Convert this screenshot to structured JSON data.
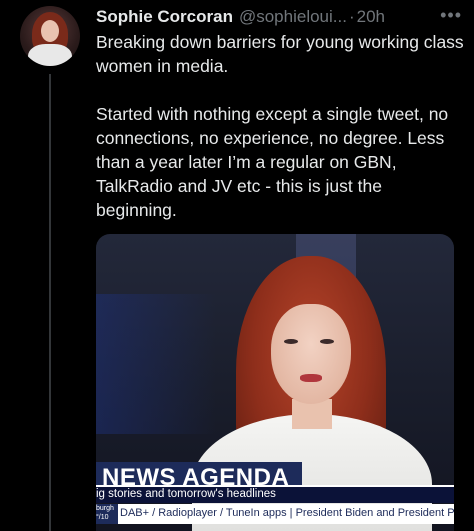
{
  "tweet": {
    "display_name": "Sophie Corcoran",
    "handle": "@sophieloui...",
    "separator": "·",
    "timestamp": "20h",
    "more_icon": "more-horizontal-icon",
    "paragraph_1": "Breaking down barriers for young working class women in media.",
    "paragraph_2": "Started with nothing except a single tweet, no connections, no experience, no degree. Less than a year later I’m a regular on GBN, TalkRadio and JV etc - this is just the beginning."
  },
  "media": {
    "chyron_title": "NEWS AGENDA",
    "chyron_sub": "ig stories and tomorrow's headlines",
    "ticker_badge": "burgh °/10",
    "ticker_text": "DAB+ / Radioplayer / TuneIn apps  |  President Biden and President Putin"
  }
}
